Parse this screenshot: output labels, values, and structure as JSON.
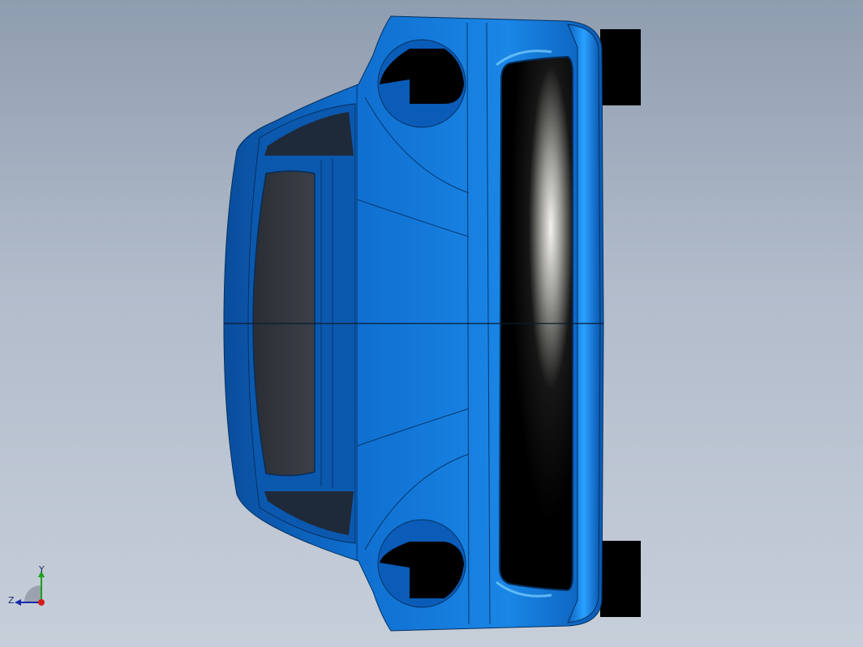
{
  "viewport": {
    "background_top": "#8f9db0",
    "background_bottom": "#c6ced9",
    "model": {
      "name": "car-body-model",
      "body_color": "#0a6fd2",
      "dark_glass_color": "#2b2f35",
      "black_color": "#000000"
    }
  },
  "triad": {
    "x_label": "",
    "y_label": "Y",
    "z_label": "Z",
    "x_color": "#d81b1b",
    "y_color": "#1ba01b",
    "z_color": "#1b2aa8"
  }
}
